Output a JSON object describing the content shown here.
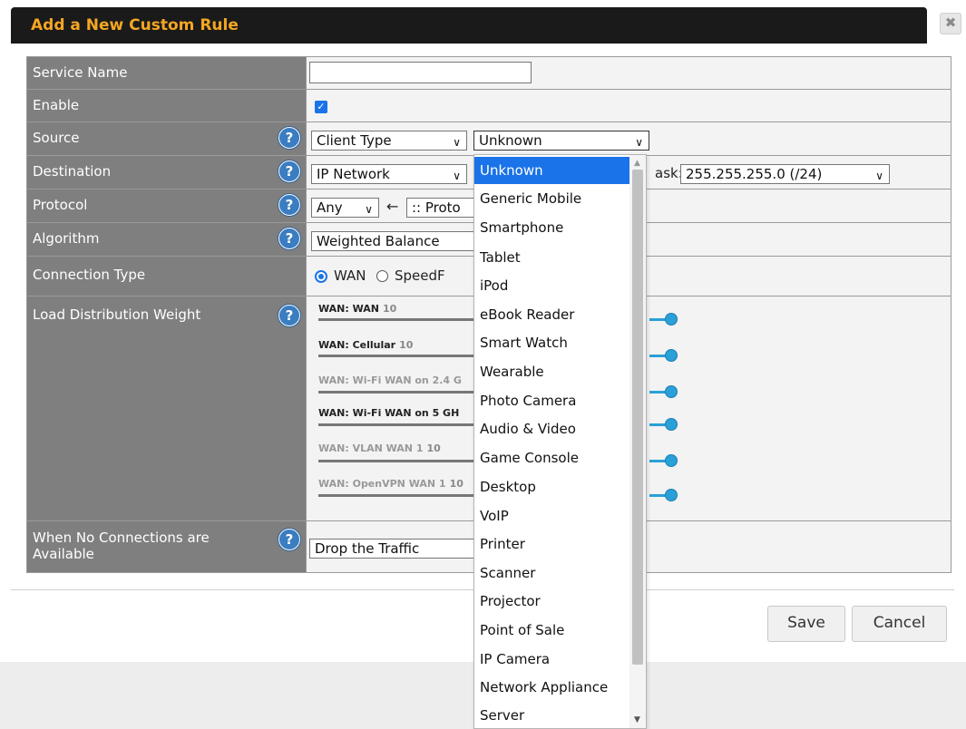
{
  "dialog": {
    "title": "Add a New Custom Rule",
    "close_icon": "close-icon"
  },
  "rows": {
    "service_name": {
      "label": "Service Name",
      "value": ""
    },
    "enable": {
      "label": "Enable",
      "checked": true
    },
    "source": {
      "label": "Source",
      "type_value": "Client Type",
      "client_value": "Unknown"
    },
    "destination": {
      "label": "Destination",
      "type_value": "IP Network",
      "mask_label": "ask:",
      "mask_value": "255.255.255.0 (/24)"
    },
    "protocol": {
      "label": "Protocol",
      "value": "Any",
      "arrow": "←",
      "preset": ":: Proto"
    },
    "algorithm": {
      "label": "Algorithm",
      "value": "Weighted Balance"
    },
    "connection_type": {
      "label": "Connection Type",
      "opt_wan": "WAN",
      "opt_speedfusion": "SpeedF"
    },
    "load_distribution": {
      "label": "Load Distribution Weight",
      "weights": [
        {
          "name": "WAN: WAN",
          "value": "10",
          "enabled": true
        },
        {
          "name": "WAN: Cellular",
          "value": "10",
          "enabled": true
        },
        {
          "name": "WAN: Wi-Fi WAN on 2.4 G",
          "value": "",
          "enabled": false
        },
        {
          "name": "WAN: Wi-Fi WAN on 5 GH",
          "value": "",
          "enabled": true
        },
        {
          "name": "WAN: VLAN WAN 1",
          "value": "10",
          "enabled": false
        },
        {
          "name": "WAN: OpenVPN WAN 1",
          "value": "10",
          "enabled": false
        }
      ]
    },
    "no_connections": {
      "label": "When No Connections are Available",
      "value": "Drop the Traffic"
    }
  },
  "buttons": {
    "save": "Save",
    "cancel": "Cancel"
  },
  "dropdown": {
    "options": [
      "Unknown",
      "Generic Mobile",
      "Smartphone",
      "Tablet",
      "iPod",
      "eBook Reader",
      "Smart Watch",
      "Wearable",
      "Photo Camera",
      "Audio & Video",
      "Game Console",
      "Desktop",
      "VoIP",
      "Printer",
      "Scanner",
      "Projector",
      "Point of Sale",
      "IP Camera",
      "Network Appliance",
      "Server"
    ],
    "selected": "Unknown"
  },
  "colors": {
    "title": "#f5a623",
    "label_bg": "#7f7f7f",
    "accent": "#1a73e8",
    "slider": "#2aa0d8"
  }
}
